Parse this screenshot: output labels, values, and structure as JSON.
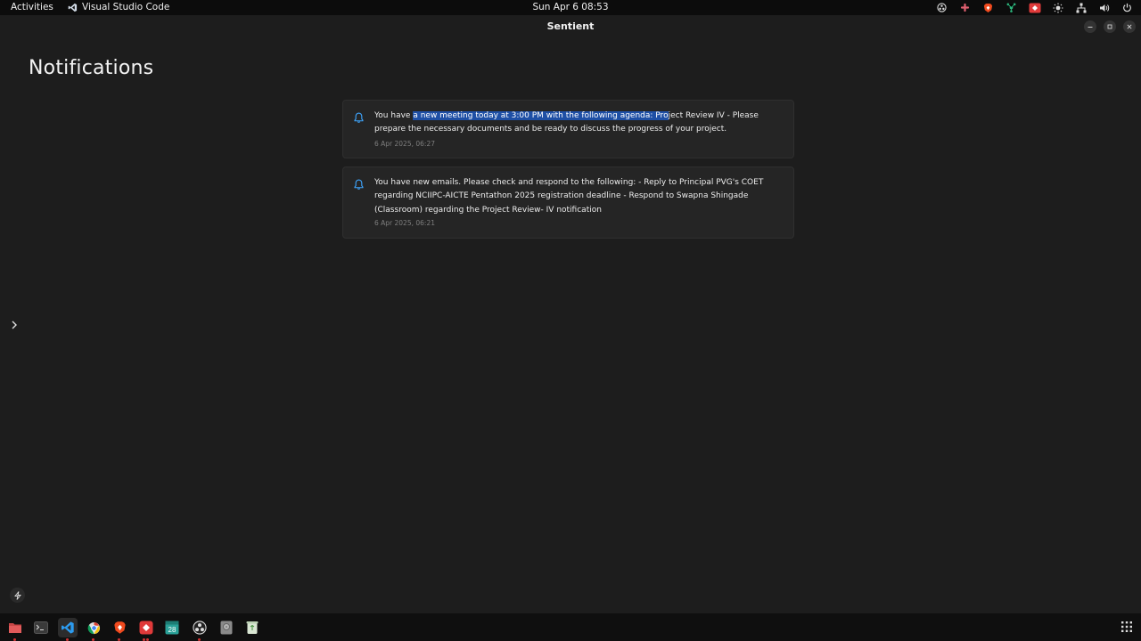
{
  "topbar": {
    "activities": "Activities",
    "app_name": "Visual Studio Code",
    "clock": "Sun Apr 6  08:53"
  },
  "window": {
    "title": "Sentient"
  },
  "page": {
    "title": "Notifications"
  },
  "notifications": [
    {
      "pre": "You have ",
      "highlighted": "a new meeting today at 3:00 PM with the following agenda: Pro",
      "post": "ject Review IV - Please prepare the necessary documents and be ready to discuss the progress of your project.",
      "time": "6 Apr 2025, 06:27"
    },
    {
      "text": "You have new emails. Please check and respond to the following: - Reply to Principal PVG's COET regarding NCIIPC-AICTE Pentathon 2025 registration deadline - Respond to Swapna Shingade (Classroom) regarding the Project Review- IV notification",
      "time": "6 Apr 2025, 06:21"
    }
  ],
  "dock": {
    "calendar_day": "28"
  },
  "colors": {
    "accent": "#3ea6ff",
    "selection": "#1e4fa5",
    "background": "#1d1d1d",
    "card": "#252525"
  }
}
